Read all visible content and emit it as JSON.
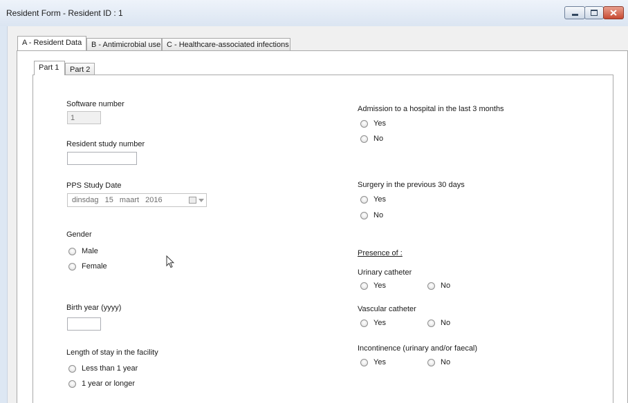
{
  "window": {
    "title": "Resident Form - Resident ID : 1"
  },
  "tabs": [
    {
      "label": "A - Resident Data"
    },
    {
      "label": "B - Antimicrobial use"
    },
    {
      "label": "C - Healthcare-associated infections"
    }
  ],
  "subtabs": [
    {
      "label": "Part 1"
    },
    {
      "label": "Part 2"
    }
  ],
  "left": {
    "software_number": {
      "label": "Software number",
      "value": "1"
    },
    "resident_study_number": {
      "label": "Resident study number",
      "value": ""
    },
    "pps_study_date": {
      "label": "PPS Study Date",
      "day_name": "dinsdag",
      "day": "15",
      "month": "maart",
      "year": "2016"
    },
    "gender": {
      "label": "Gender",
      "options": [
        "Male",
        "Female"
      ]
    },
    "birth_year": {
      "label": "Birth year (yyyy)",
      "value": ""
    },
    "length_of_stay": {
      "label": "Length of stay in the facility",
      "options": [
        "Less than 1 year",
        "1 year or longer"
      ]
    }
  },
  "right": {
    "admission": {
      "label": "Admission to a hospital in the last 3 months",
      "options": [
        "Yes",
        "No"
      ]
    },
    "surgery": {
      "label": "Surgery in the previous 30 days",
      "options": [
        "Yes",
        "No"
      ]
    },
    "presence_heading": "Presence of :",
    "urinary_catheter": {
      "label": "Urinary catheter",
      "options": [
        "Yes",
        "No"
      ]
    },
    "vascular_catheter": {
      "label": "Vascular catheter",
      "options": [
        "Yes",
        "No"
      ]
    },
    "incontinence": {
      "label": "Incontinence (urinary and/or faecal)",
      "options": [
        "Yes",
        "No"
      ]
    }
  },
  "icons": {
    "minimize": "minimize-icon",
    "maximize": "maximize-icon",
    "close": "close-icon",
    "calendar": "calendar-icon",
    "cursor": "mouse-cursor-icon"
  },
  "colors": {
    "titlebar": "#dbe5f2",
    "close_button": "#c74a32",
    "panel": "#ffffff",
    "window_bg": "#f0f0f0"
  }
}
